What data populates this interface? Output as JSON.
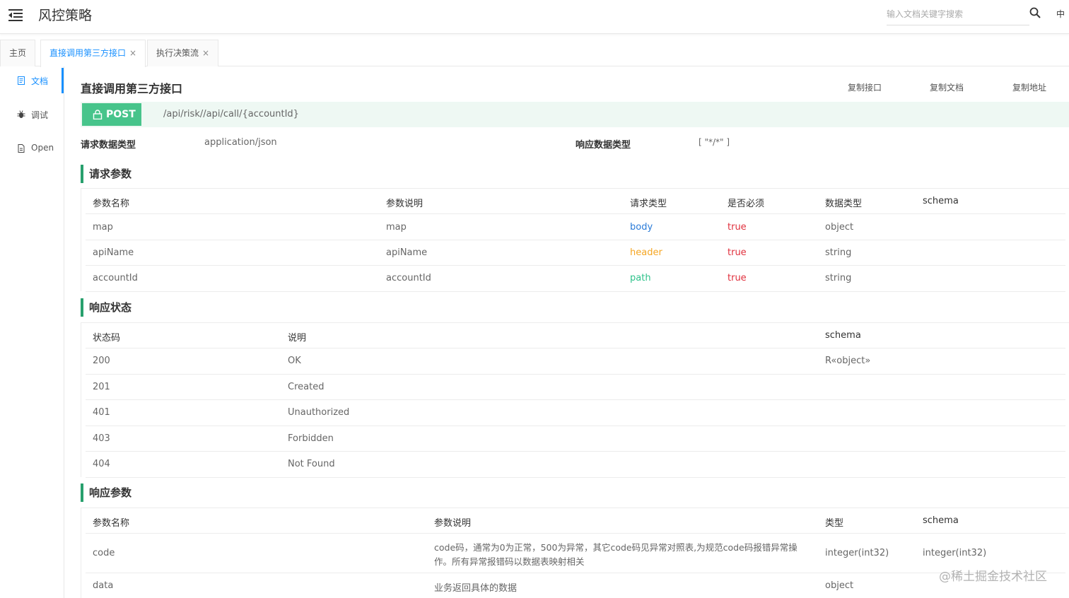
{
  "header": {
    "title": "风控策略",
    "search_placeholder": "输入文档关键字搜索",
    "lang": "中"
  },
  "tabs": [
    {
      "label": "主页",
      "closable": false
    },
    {
      "label": "直接调用第三方接口",
      "closable": true,
      "active": true
    },
    {
      "label": "执行决策流",
      "closable": true
    }
  ],
  "tab_close_glyph": "×",
  "sidebar": {
    "items": [
      {
        "label": "文档",
        "icon": "document-icon",
        "active": true
      },
      {
        "label": "调试",
        "icon": "bug-icon"
      },
      {
        "label": "Open",
        "icon": "file-icon"
      }
    ]
  },
  "api": {
    "title": "直接调用第三方接口",
    "copy_buttons": [
      "复制接口",
      "复制文档",
      "复制地址"
    ],
    "method": "POST",
    "path": "/api/risk//api/call/{accountId}",
    "request_type_label": "请求数据类型",
    "request_type": "application/json",
    "response_type_label": "响应数据类型",
    "response_type": "[ \"*/*\" ]"
  },
  "request_params": {
    "title": "请求参数",
    "headers": [
      "参数名称",
      "参数说明",
      "请求类型",
      "是否必须",
      "数据类型",
      "schema"
    ],
    "rows": [
      {
        "name": "map",
        "desc": "map",
        "in": "body",
        "required": "true",
        "type": "object",
        "schema": ""
      },
      {
        "name": "apiName",
        "desc": "apiName",
        "in": "header",
        "required": "true",
        "type": "string",
        "schema": ""
      },
      {
        "name": "accountId",
        "desc": "accountId",
        "in": "path",
        "required": "true",
        "type": "string",
        "schema": ""
      }
    ]
  },
  "response_status": {
    "title": "响应状态",
    "headers": [
      "状态码",
      "说明",
      "schema"
    ],
    "rows": [
      {
        "code": "200",
        "desc": "OK",
        "schema": "R«object»"
      },
      {
        "code": "201",
        "desc": "Created",
        "schema": ""
      },
      {
        "code": "401",
        "desc": "Unauthorized",
        "schema": ""
      },
      {
        "code": "403",
        "desc": "Forbidden",
        "schema": ""
      },
      {
        "code": "404",
        "desc": "Not Found",
        "schema": ""
      }
    ]
  },
  "response_params": {
    "title": "响应参数",
    "headers": [
      "参数名称",
      "参数说明",
      "类型",
      "schema"
    ],
    "rows": [
      {
        "name": "code",
        "desc_line1": "code码，通常为0为正常，500为异常，其它code码见异常对照表,为规范code码报错异常操",
        "desc_line2": "作。所有异常报错码以数据表映射相关",
        "type": "integer(int32)",
        "schema": "integer(int32)"
      },
      {
        "name": "data",
        "desc_line1": "业务返回具体的数据",
        "desc_line2": "",
        "type": "object",
        "schema": ""
      }
    ]
  },
  "watermark": "@稀土掘金技术社区",
  "colors": {
    "accent": "#1890ff",
    "post": "#47c48b",
    "section_bar": "#28a06d",
    "body": "#2a7bd8",
    "header": "#f5a623",
    "path": "#2fc28b",
    "required": "#e0303d"
  }
}
